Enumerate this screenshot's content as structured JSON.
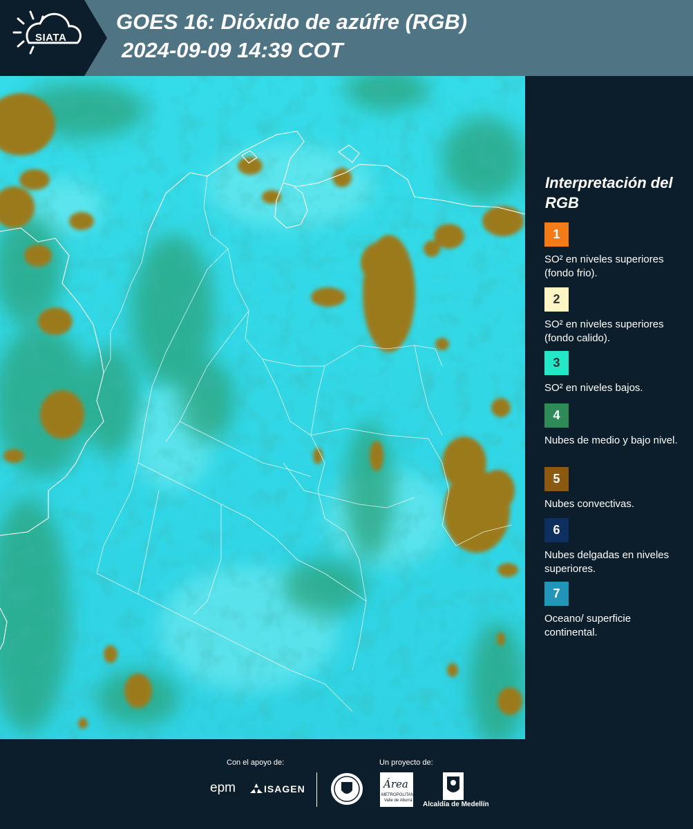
{
  "header": {
    "logo_text": "SIATA",
    "title_line1": "GOES 16: Dióxido de azúfre (RGB)",
    "title_line2": "2024-09-09 14:39 COT"
  },
  "legend": {
    "title": "Interpretación del RGB",
    "items": [
      {
        "number": "1",
        "color": "#f47c18",
        "text_color": "#ffffff",
        "text": "SO² en niveles superiores (fondo frio)."
      },
      {
        "number": "2",
        "color": "#fdf6c4",
        "text_color": "#333333",
        "text": "SO² en niveles superiores (fondo calido)."
      },
      {
        "number": "3",
        "color": "#22e8c8",
        "text_color": "#333333",
        "text": "SO² en niveles bajos."
      },
      {
        "number": "4",
        "color": "#2e8b57",
        "text_color": "#ffffff",
        "text": "Nubes de medio y bajo nivel."
      },
      {
        "number": "5",
        "color": "#8b5a10",
        "text_color": "#ffffff",
        "text": "Nubes convectivas."
      },
      {
        "number": "6",
        "color": "#0d3060",
        "text_color": "#ffffff",
        "text": "Nubes delgadas en niveles superiores."
      },
      {
        "number": "7",
        "color": "#2196b8",
        "text_color": "#ffffff",
        "text": "Oceano/ superficie continental."
      }
    ]
  },
  "footer": {
    "support_label": "Con el apoyo de:",
    "project_label": "Un proyecto de:",
    "epm_text": "epm",
    "isagen_text": "ISAGEN",
    "area_text": "Área",
    "area_sub1": "METROPOLITANA",
    "area_sub2": "Valle de Aburrá",
    "alcaldia_text": "Alcaldía de Medellín"
  }
}
